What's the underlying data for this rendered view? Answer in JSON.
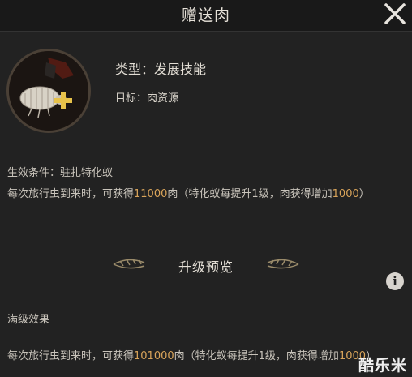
{
  "header": {
    "title": "赠送肉"
  },
  "skill": {
    "icon": "larva-plus-icon",
    "type_line": "类型：发展技能",
    "target_line": "目标：肉资源"
  },
  "effect": {
    "condition": "生效条件：驻扎特化蚁",
    "desc_part1": "每次旅行虫到来时，可获得",
    "desc_value1": "11000",
    "desc_part2": "肉（特化蚁每提升1级，肉获得增加",
    "desc_value2": "1000",
    "desc_part3": "）"
  },
  "upgrade": {
    "section_title": "升级预览",
    "max_title": "满级效果",
    "desc_part1": "每次旅行虫到来时，可获得",
    "desc_value1": "101000",
    "desc_part2": "肉（特化蚁每提升1级，肉获得增加",
    "desc_value2": "1000",
    "desc_part3": "）"
  },
  "watermark": "酷乐米",
  "colors": {
    "highlight": "#d9a45a",
    "background": "#222222",
    "header": "#191919"
  }
}
